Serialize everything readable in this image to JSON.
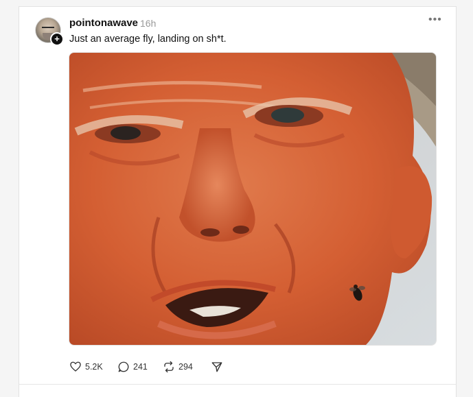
{
  "post": {
    "username": "pointonawave",
    "time": "16h",
    "more_label": "•••",
    "caption": "Just an average fly, landing on sh*t.",
    "follow_badge": "+",
    "image_icon": "photo-of-face-with-fly"
  },
  "actions": {
    "likes": "5.2K",
    "comments": "241",
    "reposts": "294",
    "like_icon": "heart-icon",
    "comment_icon": "comment-bubble-icon",
    "repost_icon": "repost-icon",
    "share_icon": "send-icon"
  }
}
